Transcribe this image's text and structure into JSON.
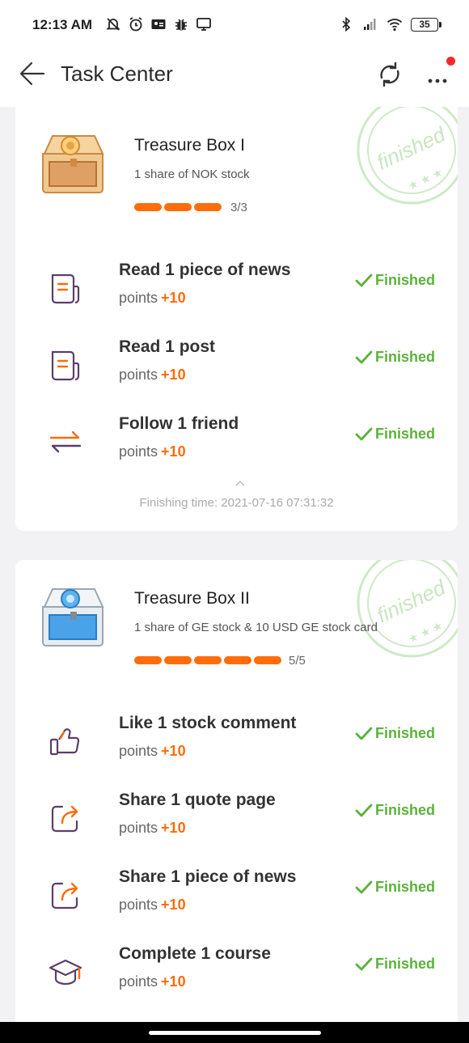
{
  "status_bar": {
    "time": "12:13 AM",
    "battery": "35",
    "left_icons": [
      "mute-bell-icon",
      "alarm-icon",
      "contact-card-icon",
      "bug-icon",
      "monitor-icon"
    ],
    "right_icons": [
      "bluetooth-icon",
      "signal-icon",
      "wifi-icon",
      "battery-icon"
    ]
  },
  "header": {
    "title": "Task Center",
    "back_icon": "arrow-left-icon",
    "refresh_icon": "refresh-icon",
    "more_icon": "more-dots-icon",
    "notification_dot_color": "#ee2b2b"
  },
  "colors": {
    "accent_orange": "#ff6c0a",
    "finished_green": "#5bb23a",
    "icon_purple": "#5a3f6b"
  },
  "boxes": [
    {
      "title": "Treasure Box I",
      "reward": "1 share of NOK stock",
      "progress_done": 3,
      "progress_total": 3,
      "progress_text": "3/3",
      "stamp_text": "finished",
      "tasks": [
        {
          "name": "Read 1 piece of news",
          "points_label": "points",
          "points": "+10",
          "status": "Finished",
          "icon": "document-icon"
        },
        {
          "name": "Read 1 post",
          "points_label": "points",
          "points": "+10",
          "status": "Finished",
          "icon": "document-icon"
        },
        {
          "name": "Follow 1 friend",
          "points_label": "points",
          "points": "+10",
          "status": "Finished",
          "icon": "swap-arrows-icon"
        }
      ],
      "finishing_time": "Finishing time: 2021-07-16 07:31:32"
    },
    {
      "title": "Treasure Box II",
      "reward": "1 share of GE stock & 10 USD GE stock card",
      "progress_done": 5,
      "progress_total": 5,
      "progress_text": "5/5",
      "stamp_text": "finished",
      "tasks": [
        {
          "name": "Like 1 stock comment",
          "points_label": "points",
          "points": "+10",
          "status": "Finished",
          "icon": "thumbs-up-icon"
        },
        {
          "name": "Share 1 quote page",
          "points_label": "points",
          "points": "+10",
          "status": "Finished",
          "icon": "share-icon"
        },
        {
          "name": "Share 1 piece of news",
          "points_label": "points",
          "points": "+10",
          "status": "Finished",
          "icon": "share-icon"
        },
        {
          "name": "Complete 1 course",
          "points_label": "points",
          "points": "+10",
          "status": "Finished",
          "icon": "graduation-cap-icon"
        }
      ]
    }
  ]
}
